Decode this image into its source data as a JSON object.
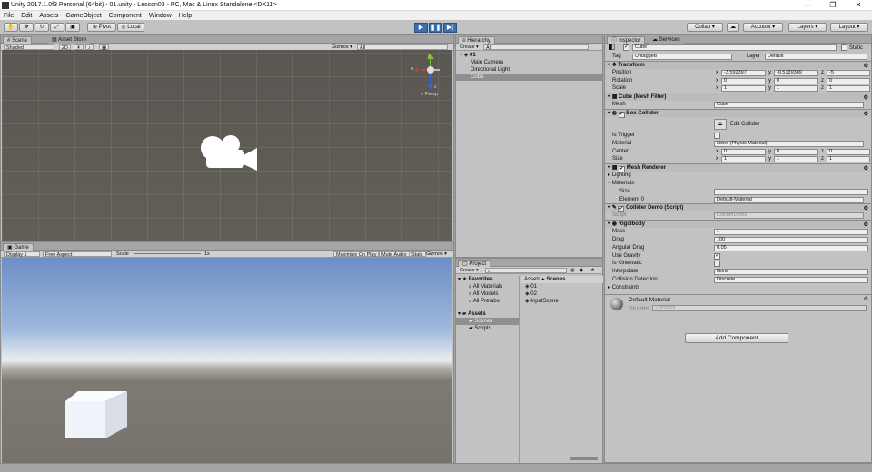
{
  "window": {
    "title": "Unity 2017.1.0f3 Personal (64bit) - 01.unity - Lesson03 - PC, Mac & Linux Standalone <DX11>",
    "minimize": "—",
    "maximize": "❐",
    "close": "✕"
  },
  "menu": [
    "File",
    "Edit",
    "Assets",
    "GameObject",
    "Component",
    "Window",
    "Help"
  ],
  "toolbar": {
    "pivot": "Pivot",
    "local": "Local",
    "collab": "Collab ▾",
    "account": "Account",
    "layers": "Layers",
    "layout": "Layout",
    "play": "▶",
    "pause": "❚❚",
    "step": "▶|"
  },
  "scene": {
    "tab_scene": "Scene",
    "tab_store": "Asset Store",
    "shaded": "Shaded",
    "mode2d": "2D",
    "gizmos": "Gizmos ▾",
    "search": "All",
    "persp": "< Persp"
  },
  "game": {
    "tab": "Game",
    "display": "Display 1",
    "aspect": "Free Aspect",
    "scale_label": "Scale",
    "scale_value": "1x",
    "maximize": "Maximize On Play",
    "mute": "Mute Audio",
    "stats": "Stats",
    "gizmos": "Gizmos ▾"
  },
  "hierarchy": {
    "tab": "Hierarchy",
    "create": "Create ▾",
    "search": "All",
    "scene_name": "01",
    "items": [
      "Main Camera",
      "Directional Light",
      "Cube"
    ]
  },
  "project": {
    "tab": "Project",
    "create": "Create ▾",
    "favorites_label": "Favorites",
    "favorites": [
      "All Materials",
      "All Models",
      "All Prefabs"
    ],
    "assets_label": "Assets",
    "folders": [
      "Scenes",
      "Scripts"
    ],
    "breadcrumb": [
      "Assets",
      "Scenes"
    ],
    "files": [
      "01",
      "02",
      "InputScene"
    ]
  },
  "inspector": {
    "tab_inspector": "Inspector",
    "tab_services": "Services",
    "object_name": "Cube",
    "static_label": "Static",
    "tag_label": "Tag",
    "tag_value": "Untagged",
    "layer_label": "Layer",
    "layer_value": "Default",
    "transform": {
      "title": "Transform",
      "position": {
        "label": "Position",
        "x": "-3.592397",
        "y": "-0.5139389",
        "z": "-5"
      },
      "rotation": {
        "label": "Rotation",
        "x": "0",
        "y": "0",
        "z": "0"
      },
      "scale": {
        "label": "Scale",
        "x": "1",
        "y": "1",
        "z": "1"
      }
    },
    "mesh_filter": {
      "title": "Cube (Mesh Filter)",
      "mesh_label": "Mesh",
      "mesh_value": "Cube"
    },
    "box_collider": {
      "title": "Box Collider",
      "edit_collider": "Edit Collider",
      "is_trigger": "Is Trigger",
      "material_label": "Material",
      "material_value": "None (Physic Material)",
      "center_label": "Center",
      "cx": "0",
      "cy": "0",
      "cz": "0",
      "size_label": "Size",
      "sx": "1",
      "sy": "1",
      "sz": "1"
    },
    "mesh_renderer": {
      "title": "Mesh Renderer",
      "lighting": "Lighting",
      "materials": "Materials",
      "size_label": "Size",
      "size_value": "1",
      "element_label": "Element 0",
      "element_value": "Default-Material"
    },
    "collider_demo": {
      "title": "Collider Demo (Script)",
      "script_label": "Script",
      "script_value": "ColliderDemo"
    },
    "rigidbody": {
      "title": "Rigidbody",
      "mass_label": "Mass",
      "mass": "1",
      "drag_label": "Drag",
      "drag": "100",
      "angular_label": "Angular Drag",
      "angular": "0.05",
      "gravity_label": "Use Gravity",
      "kinematic_label": "Is Kinematic",
      "interpolate_label": "Interpolate",
      "interpolate": "None",
      "collision_label": "Collision Detection",
      "collision": "Discrete",
      "constraints_label": "Constraints"
    },
    "material": {
      "name": "Default-Material",
      "shader_label": "Shader",
      "shader_value": "Standard"
    },
    "add_component": "Add Component"
  },
  "axis": {
    "x": "x",
    "y": "y",
    "z": "z"
  }
}
